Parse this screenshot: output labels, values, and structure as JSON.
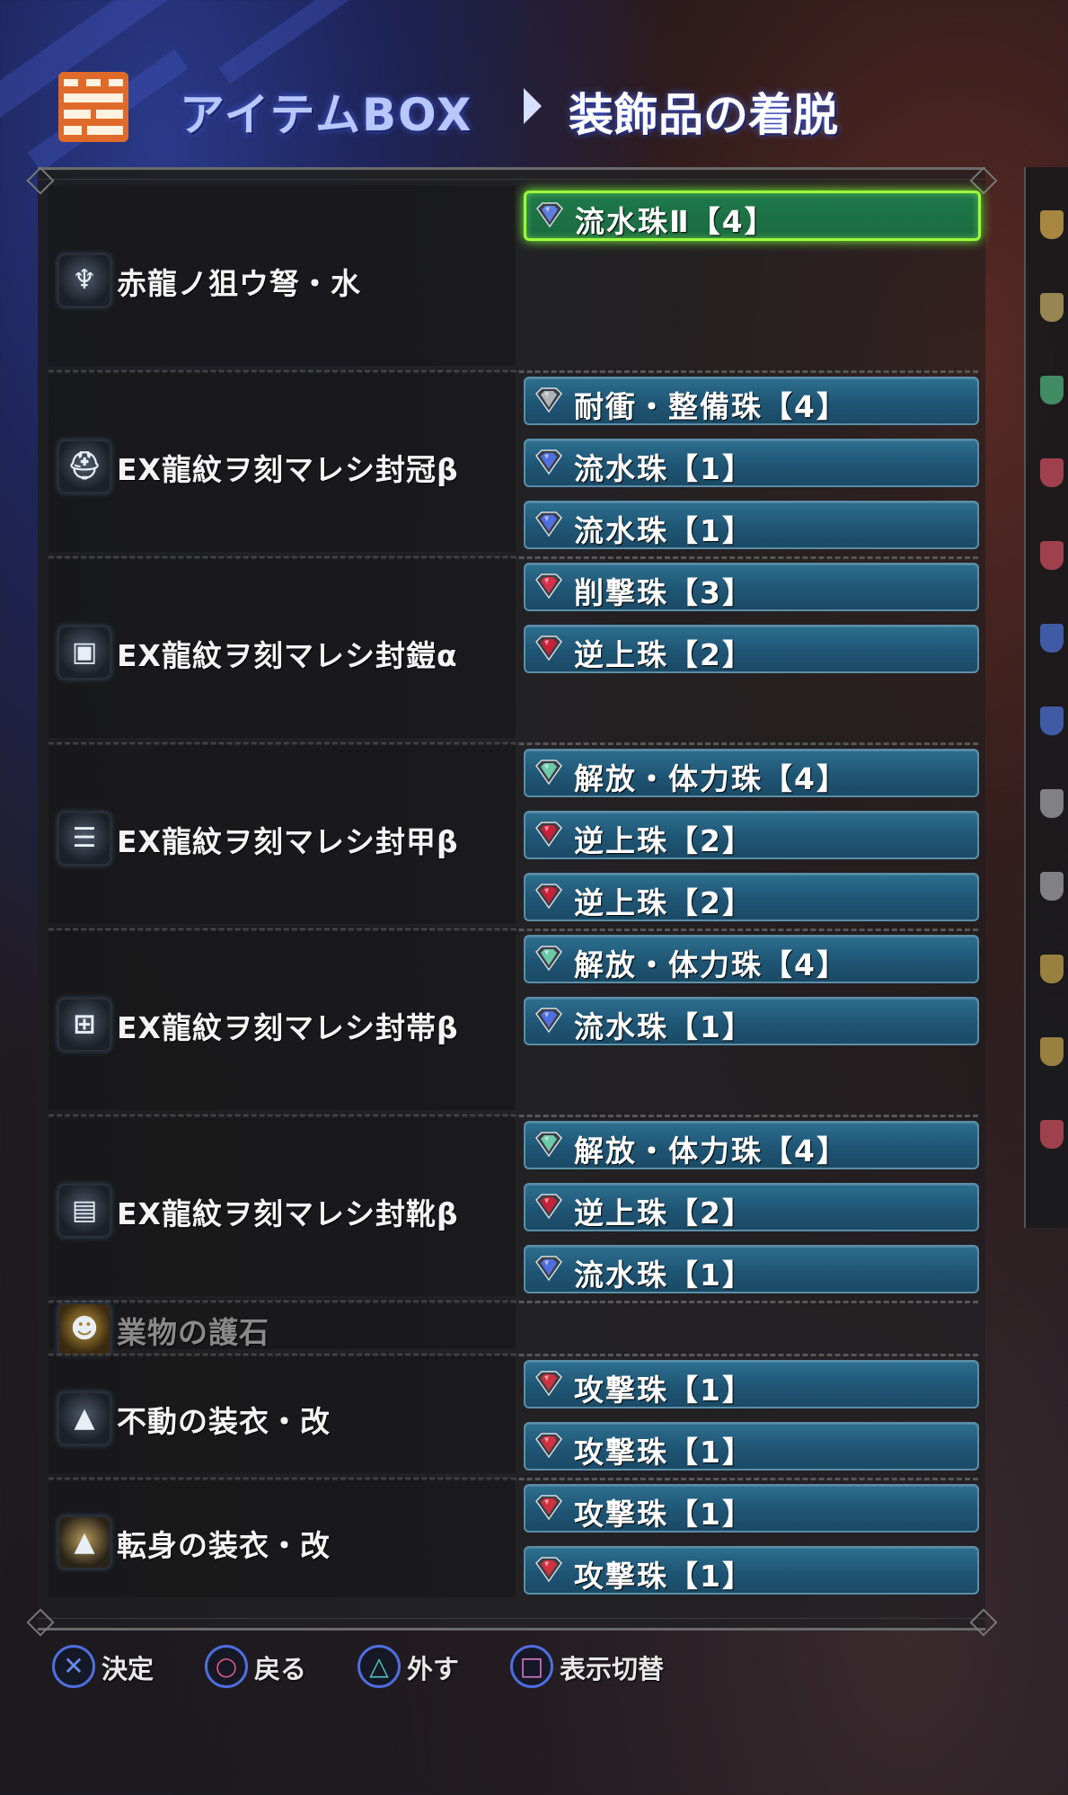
{
  "header": {
    "title": "アイテムBOX",
    "subtitle": "装飾品の着脱",
    "icon": "item-box-icon"
  },
  "equipment": [
    {
      "name": "赤龍ノ狙ウ弩・水",
      "icon": "bowgun-icon",
      "slots": [
        {
          "label": "流水珠Ⅱ【4】",
          "gem_color": "#5d7fe0",
          "selected": true
        }
      ]
    },
    {
      "name": "EX龍紋ヲ刻マレシ封冠β",
      "icon": "helm-icon",
      "slots": [
        {
          "label": "耐衝・整備珠【4】",
          "gem_color": "#b0b4b8"
        },
        {
          "label": "流水珠【1】",
          "gem_color": "#4f6fe0"
        },
        {
          "label": "流水珠【1】",
          "gem_color": "#4f6fe0"
        }
      ]
    },
    {
      "name": "EX龍紋ヲ刻マレシ封鎧α",
      "icon": "chest-icon",
      "slots": [
        {
          "label": "削撃珠【3】",
          "gem_color": "#d8304a"
        },
        {
          "label": "逆上珠【2】",
          "gem_color": "#c8203a"
        }
      ]
    },
    {
      "name": "EX龍紋ヲ刻マレシ封甲β",
      "icon": "arms-icon",
      "slots": [
        {
          "label": "解放・体力珠【4】",
          "gem_color": "#6cc8a8"
        },
        {
          "label": "逆上珠【2】",
          "gem_color": "#c8203a"
        },
        {
          "label": "逆上珠【2】",
          "gem_color": "#c8203a"
        }
      ]
    },
    {
      "name": "EX龍紋ヲ刻マレシ封帯β",
      "icon": "waist-icon",
      "slots": [
        {
          "label": "解放・体力珠【4】",
          "gem_color": "#6cc8a8"
        },
        {
          "label": "流水珠【1】",
          "gem_color": "#4f6fe0"
        }
      ]
    },
    {
      "name": "EX龍紋ヲ刻マレシ封靴β",
      "icon": "legs-icon",
      "slots": [
        {
          "label": "解放・体力珠【4】",
          "gem_color": "#6cc8a8"
        },
        {
          "label": "逆上珠【2】",
          "gem_color": "#c8203a"
        },
        {
          "label": "流水珠【1】",
          "gem_color": "#4f6fe0"
        }
      ]
    },
    {
      "name": "業物の護石",
      "icon": "charm-icon",
      "dim": true,
      "slots": []
    },
    {
      "name": "不動の装衣・改",
      "icon": "mantle-icon",
      "slots": [
        {
          "label": "攻撃珠【1】",
          "gem_color": "#d03040"
        },
        {
          "label": "攻撃珠【1】",
          "gem_color": "#d03040"
        }
      ]
    },
    {
      "name": "転身の装衣・改",
      "icon": "mantle-gold-icon",
      "slots": [
        {
          "label": "攻撃珠【1】",
          "gem_color": "#d03040"
        },
        {
          "label": "攻撃珠【1】",
          "gem_color": "#d03040"
        }
      ]
    }
  ],
  "footer": {
    "confirm": {
      "glyph": "✕",
      "label": "決定",
      "color": "#6a8cf0"
    },
    "back": {
      "glyph": "○",
      "label": "戻る",
      "color": "#e05a7a"
    },
    "remove": {
      "glyph": "△",
      "label": "外す",
      "color": "#4fc8c0"
    },
    "toggle": {
      "glyph": "□",
      "label": "表示切替",
      "color": "#d87ac8"
    }
  },
  "colors": {
    "slot_blue": "#1f5574",
    "selected_green": "#9cff3a",
    "header_blue": "#b8c8ff"
  }
}
